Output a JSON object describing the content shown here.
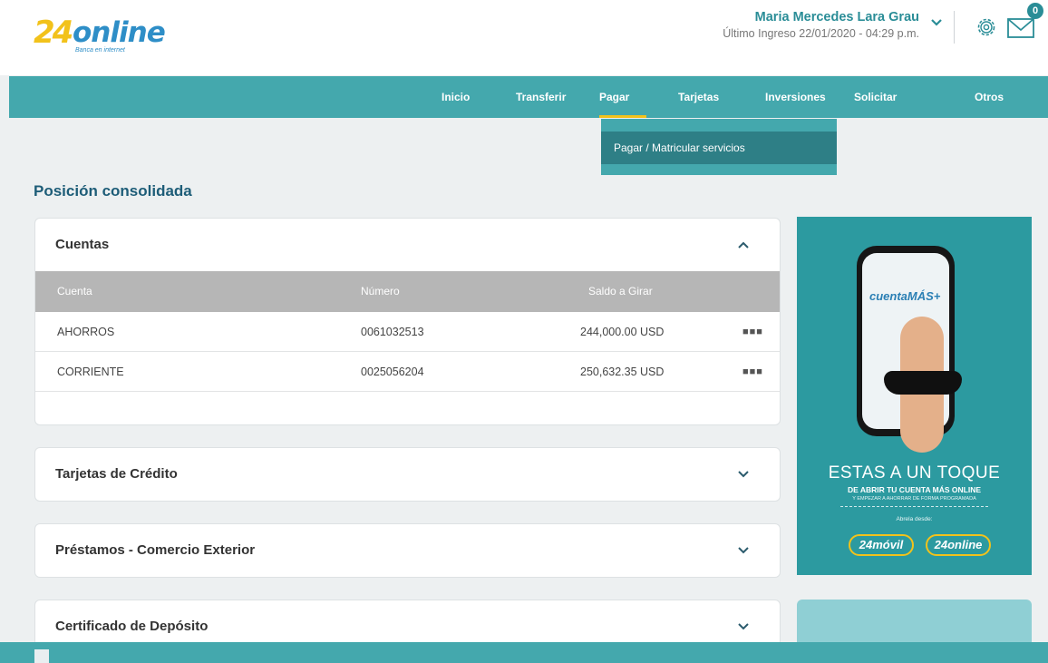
{
  "logo": {
    "mark": "24",
    "word": "online",
    "sub": "Banca en internet"
  },
  "user": {
    "name": "Maria Mercedes Lara Grau",
    "last_login": "Último Ingreso 22/01/2020 - 04:29 p.m."
  },
  "notifications": {
    "count": "0"
  },
  "nav": {
    "items": [
      "Inicio",
      "Transferir",
      "Pagar",
      "Tarjetas",
      "Inversiones",
      "Solicitar",
      "Otros"
    ],
    "active": "Pagar"
  },
  "dropdown": {
    "items": [
      "Pagar / Matricular servicios"
    ]
  },
  "section_title": "Posición consolidada",
  "accounts": {
    "title": "Cuentas",
    "headers": [
      "Cuenta",
      "Número",
      "Saldo a Girar"
    ],
    "rows": [
      {
        "type": "AHORROS",
        "number": "0061032513",
        "balance": "244,000.00 USD"
      },
      {
        "type": "CORRIENTE",
        "number": "0025056204",
        "balance": "250,632.35 USD"
      }
    ]
  },
  "cards": [
    "Tarjetas de Crédito",
    "Préstamos - Comercio Exterior",
    "Certificado de Depósito"
  ],
  "ad": {
    "screen_logo": "cuentaMÁS+",
    "headline": "ESTAS A UN TOQUE",
    "line1": "DE ABRIR TU CUENTA MÁS ONLINE",
    "line2": "Y EMPEZAR A AHORRAR DE FORMA PROGRAMADA",
    "line3": "Abrela desde:",
    "pill1": "24móvil",
    "pill2": "24online"
  },
  "colors": {
    "brand": "#44a8ad",
    "accent": "#f2c21b",
    "title": "#1e5d78"
  }
}
